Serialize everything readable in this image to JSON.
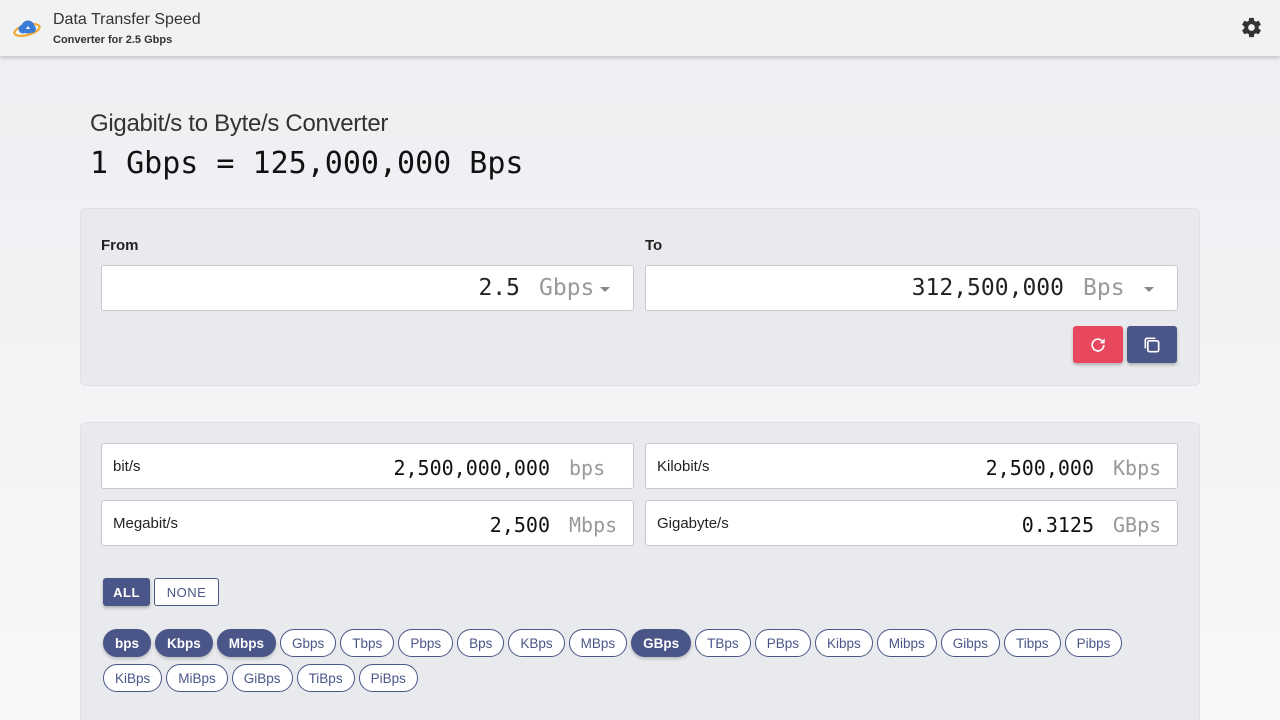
{
  "app": {
    "title": "Data Transfer Speed",
    "subtitle": "Converter for 2.5 Gbps"
  },
  "page": {
    "heading": "Gigabit/s to Byte/s Converter",
    "equation": "1 Gbps = 125,000,000 Bps"
  },
  "converter": {
    "from_label": "From",
    "to_label": "To",
    "from_value": "2.5",
    "from_unit": "Gbps",
    "to_value": "312,500,000",
    "to_unit": "Bps"
  },
  "results": [
    {
      "label": "bit/s",
      "value": "2,500,000,000",
      "unit": "bps"
    },
    {
      "label": "Kilobit/s",
      "value": "2,500,000",
      "unit": "Kbps"
    },
    {
      "label": "Megabit/s",
      "value": "2,500",
      "unit": "Mbps"
    },
    {
      "label": "Gigabyte/s",
      "value": "0.3125",
      "unit": "GBps"
    }
  ],
  "toggles": {
    "all": "ALL",
    "none": "NONE"
  },
  "chips_row1": [
    {
      "label": "bps",
      "selected": true
    },
    {
      "label": "Kbps",
      "selected": true
    },
    {
      "label": "Mbps",
      "selected": true
    },
    {
      "label": "Gbps",
      "selected": false
    },
    {
      "label": "Tbps",
      "selected": false
    },
    {
      "label": "Pbps",
      "selected": false
    },
    {
      "label": "Bps",
      "selected": false
    },
    {
      "label": "KBps",
      "selected": false
    },
    {
      "label": "MBps",
      "selected": false
    },
    {
      "label": "GBps",
      "selected": true
    },
    {
      "label": "TBps",
      "selected": false
    },
    {
      "label": "PBps",
      "selected": false
    },
    {
      "label": "Kibps",
      "selected": false
    },
    {
      "label": "Mibps",
      "selected": false
    },
    {
      "label": "Gibps",
      "selected": false
    },
    {
      "label": "Tibps",
      "selected": false
    },
    {
      "label": "Pibps",
      "selected": false
    }
  ],
  "chips_row2": [
    {
      "label": "KiBps",
      "selected": false
    },
    {
      "label": "MiBps",
      "selected": false
    },
    {
      "label": "GiBps",
      "selected": false
    },
    {
      "label": "TiBps",
      "selected": false
    },
    {
      "label": "PiBps",
      "selected": false
    }
  ],
  "colors": {
    "primary": "#4b5688",
    "reset": "#e8475e"
  },
  "icons": {
    "logo": "cloud-transfer-logo",
    "settings": "gear-icon",
    "reset": "refresh-icon",
    "copy": "copy-icon"
  }
}
